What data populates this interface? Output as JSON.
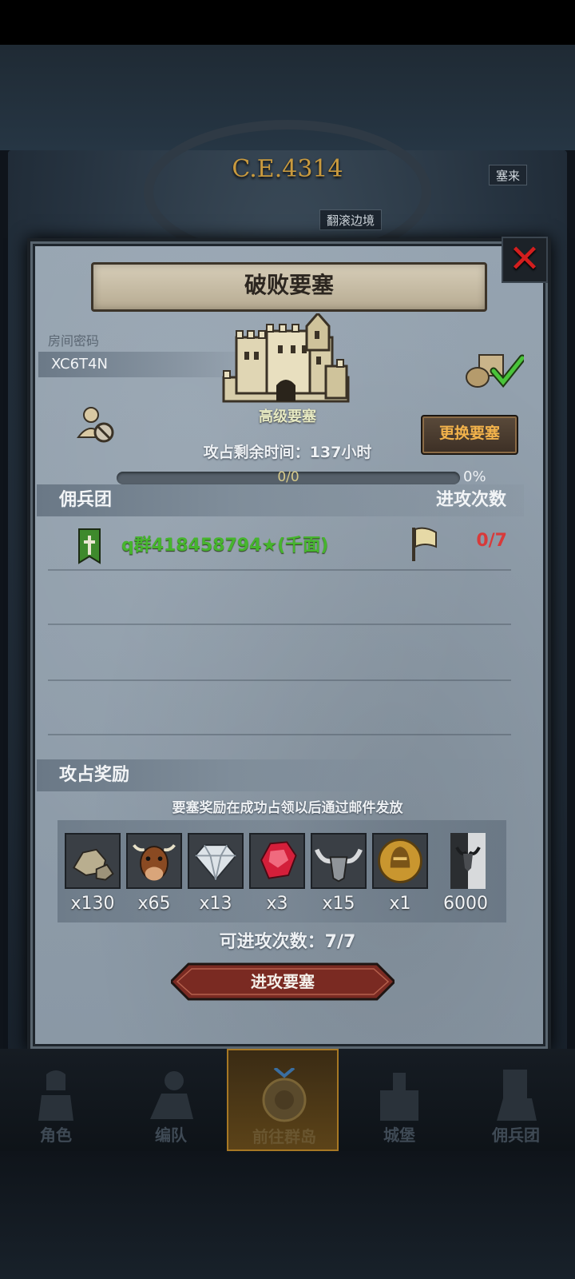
{
  "world": {
    "year": "C.E.4314",
    "tags": [
      "塞来",
      "翻滚边境"
    ]
  },
  "dialog": {
    "title": "破败要塞",
    "close_icon": "close-x-icon",
    "room": {
      "label": "房间密码",
      "code": "XC6T4N"
    },
    "fortress": {
      "icon": "castle-icon",
      "level": "高级要塞"
    },
    "change_button": "更换要塞",
    "time_remaining": "攻占剩余时间：137小时",
    "progress": {
      "text": "0/0",
      "percent_label": "0%",
      "value": 0
    },
    "mercenary_section": {
      "title": "佣兵团",
      "count_header": "进攻次数",
      "rows": [
        {
          "name": "q群418458794★(千面)",
          "attacks": "0/7"
        }
      ]
    },
    "rewards_section": {
      "title": "攻占奖励",
      "note": "要塞奖励在成功占领以后通过邮件发放",
      "items": [
        {
          "icon": "stone-icon",
          "qty": "x130"
        },
        {
          "icon": "cattle-icon",
          "qty": "x65"
        },
        {
          "icon": "diamond-icon",
          "qty": "x13"
        },
        {
          "icon": "ruby-icon",
          "qty": "x3"
        },
        {
          "icon": "bull-horn-icon",
          "qty": "x15"
        },
        {
          "icon": "knight-medal-icon",
          "qty": "x1"
        },
        {
          "icon": "bull-banner-icon",
          "qty": "6000"
        }
      ]
    },
    "remaining_attacks": "可进攻次数：7/7",
    "attack_button": "进攻要塞"
  },
  "nav": [
    {
      "label": "角色",
      "icon": "knight-icon",
      "active": false
    },
    {
      "label": "编队",
      "icon": "formation-icon",
      "active": false
    },
    {
      "label": "前往群岛",
      "icon": "compass-icon",
      "active": true
    },
    {
      "label": "城堡",
      "icon": "castle-nav-icon",
      "active": false
    },
    {
      "label": "佣兵团",
      "icon": "mercenary-icon",
      "active": false
    }
  ],
  "colors": {
    "accent_gold": "#c99a3e",
    "team_green": "#46b52e",
    "count_red": "#d83a3a",
    "button_orange": "#f2b24b"
  }
}
